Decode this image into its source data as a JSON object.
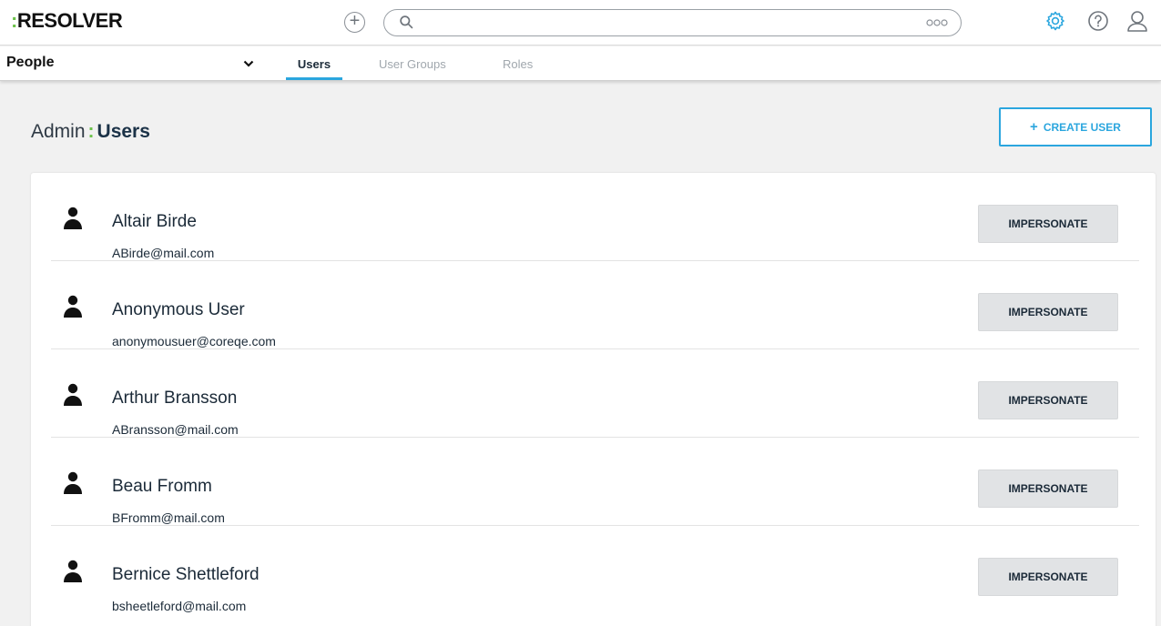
{
  "brand": {
    "logo_colon": ":",
    "logo_text": "RESOLVER",
    "accent": "#2ba6de",
    "logo_color": "#6cc24a"
  },
  "topbar": {
    "add_icon": "plus-circle-icon",
    "search_placeholder": "",
    "search_icon": "search-icon",
    "more_icon": "more-dots-icon",
    "settings_icon": "gear-icon",
    "help_icon": "help-icon",
    "user_icon": "user-icon"
  },
  "subnav": {
    "app_name": "People",
    "tabs": [
      {
        "label": "Users",
        "active": true
      },
      {
        "label": "User Groups",
        "active": false
      },
      {
        "label": "Roles",
        "active": false
      }
    ]
  },
  "page": {
    "title_prefix": "Admin",
    "title_sep": ":",
    "title_main": "Users",
    "create_plus": "+",
    "create_label": "CREATE USER"
  },
  "users": [
    {
      "name": "Altair Birde",
      "email": "ABirde@mail.com",
      "action": "IMPERSONATE"
    },
    {
      "name": "Anonymous User",
      "email": "anonymousuer@coreqe.com",
      "action": "IMPERSONATE"
    },
    {
      "name": "Arthur Bransson",
      "email": "ABransson@mail.com",
      "action": "IMPERSONATE"
    },
    {
      "name": "Beau Fromm",
      "email": "BFromm@mail.com",
      "action": "IMPERSONATE"
    },
    {
      "name": "Bernice Shettleford",
      "email": "bsheetleford@mail.com",
      "action": "IMPERSONATE"
    }
  ]
}
